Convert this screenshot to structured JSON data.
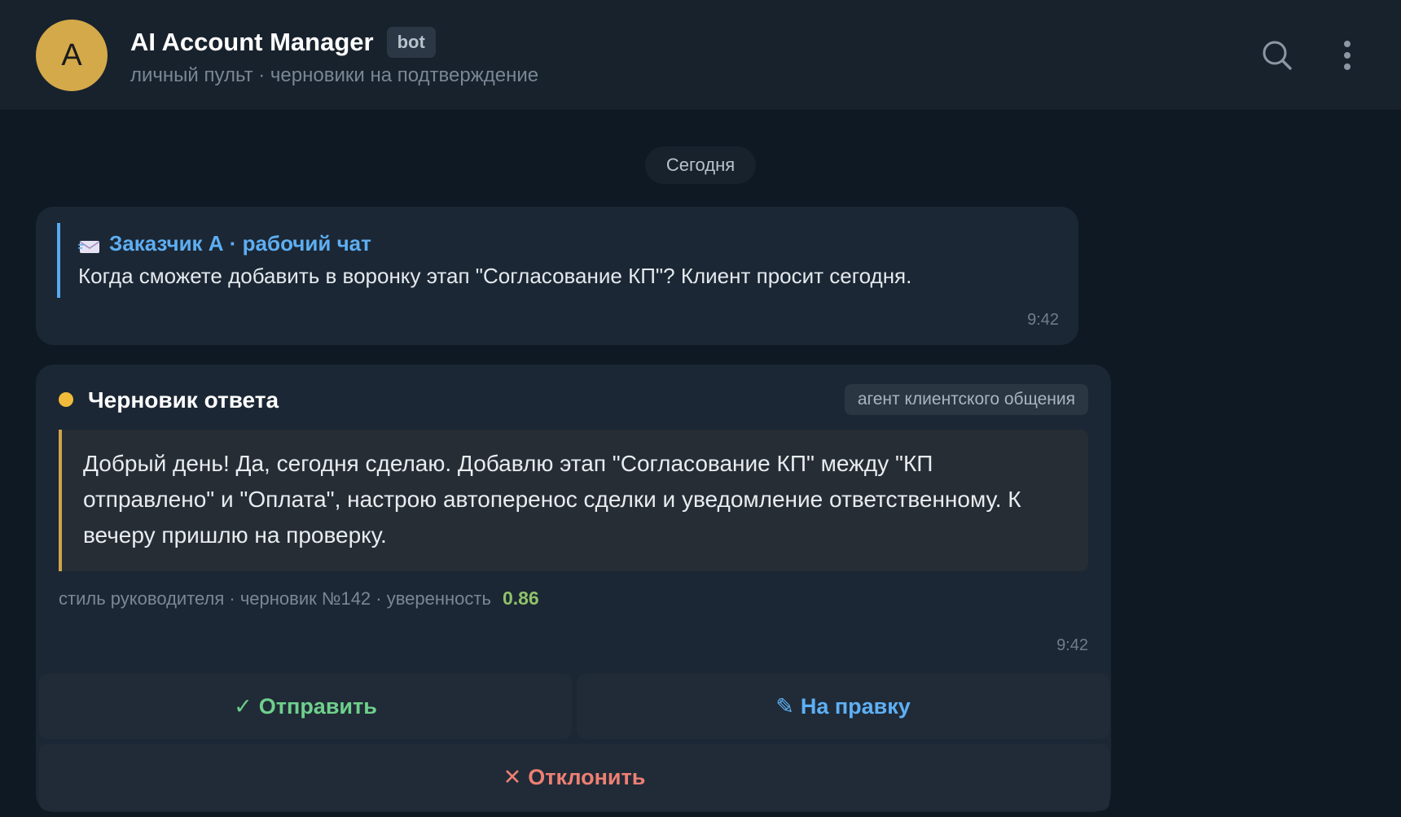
{
  "header": {
    "avatar_letter": "A",
    "title": "AI Account Manager",
    "badge": "bot",
    "subtitle": "личный пульт · черновики на подтверждение",
    "icons": [
      "search-icon",
      "more-vertical-icon"
    ]
  },
  "date_separator": "Сегодня",
  "incoming": {
    "source_icon": "envelope-icon",
    "source": "Заказчик А · рабочий чат",
    "text": "Когда сможете добавить в воронку этап \"Согласование КП\"? Клиент просит сегодня.",
    "time": "9:42"
  },
  "draft": {
    "title": "Черновик ответа",
    "agent": "агент клиентского общения",
    "text": "Добрый день! Да, сегодня сделаю. Добавлю этап \"Согласование КП\" между \"КП отправлено\" и \"Оплата\", настрою автоперенос сделки и уведомление ответственному. К вечеру пришлю на проверку.",
    "meta": "стиль руководителя · черновик №142 · уверенность",
    "confidence": "0.86",
    "time": "9:42",
    "status_color": "#f2bb3a"
  },
  "actions": {
    "send_icon": "✓",
    "send": "Отправить",
    "edit_icon": "✎",
    "edit": "На правку",
    "reject_icon": "✕",
    "reject": "Отклонить"
  },
  "colors": {
    "background": "#0f1923",
    "header": "#18222d",
    "bubble": "#1b2734",
    "accent_blue": "#5eaef2",
    "accent_green": "#6fd08c",
    "accent_red": "#ee7f73",
    "avatar": "#d4a94a"
  }
}
